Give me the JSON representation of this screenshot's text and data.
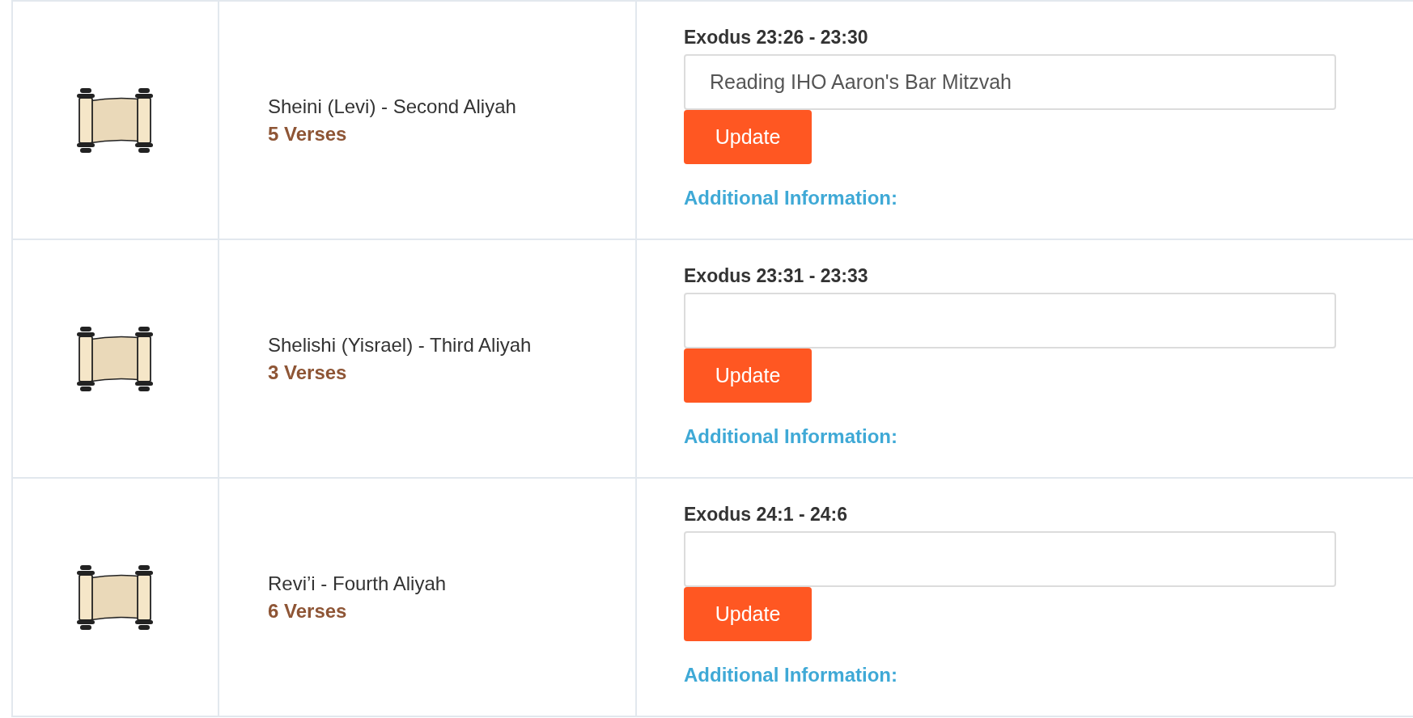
{
  "aliyot": [
    {
      "name": "Sheini (Levi) - Second Aliyah",
      "verses": "5 Verses",
      "passage": "Exodus 23:26 - 23:30",
      "dedication": "Reading IHO Aaron's Bar Mitzvah",
      "button": "Update",
      "link": "Additional Information:"
    },
    {
      "name": "Shelishi (Yisrael) - Third Aliyah",
      "verses": "3 Verses",
      "passage": "Exodus 23:31 - 23:33",
      "button": "Update",
      "link": "Additional Information:"
    },
    {
      "name": "Revi’i - Fourth Aliyah",
      "verses": "6 Verses",
      "passage": "Exodus 24:1 - 24:6",
      "button": "Update",
      "link": "Additional Information:"
    }
  ]
}
